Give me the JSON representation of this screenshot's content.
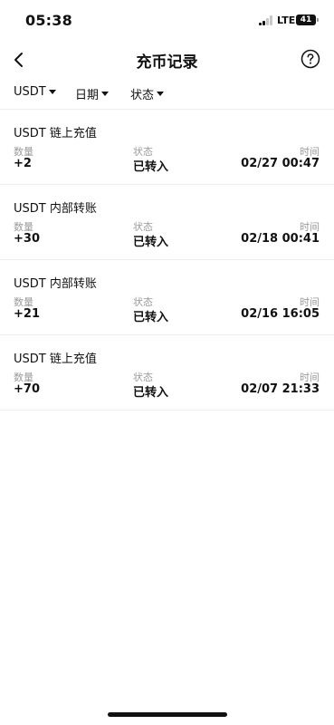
{
  "status_bar": {
    "time": "05:38",
    "network": "LTE",
    "battery": "41"
  },
  "nav": {
    "title": "充币记录"
  },
  "filters": [
    {
      "label": "USDT"
    },
    {
      "label": "日期"
    },
    {
      "label": "状态"
    }
  ],
  "records": [
    {
      "title": "USDT 链上充值",
      "amount_label": "数量",
      "amount": "+2",
      "status_label": "状态",
      "status": "已转入",
      "time_label": "时间",
      "time": "02/27 00:47"
    },
    {
      "title": "USDT 内部转账",
      "amount_label": "数量",
      "amount": "+30",
      "status_label": "状态",
      "status": "已转入",
      "time_label": "时间",
      "time": "02/18 00:41"
    },
    {
      "title": "USDT 内部转账",
      "amount_label": "数量",
      "amount": "+21",
      "status_label": "状态",
      "status": "已转入",
      "time_label": "时间",
      "time": "02/16 16:05"
    },
    {
      "title": "USDT 链上充值",
      "amount_label": "数量",
      "amount": "+70",
      "status_label": "状态",
      "status": "已转入",
      "time_label": "时间",
      "time": "02/07 21:33"
    }
  ]
}
